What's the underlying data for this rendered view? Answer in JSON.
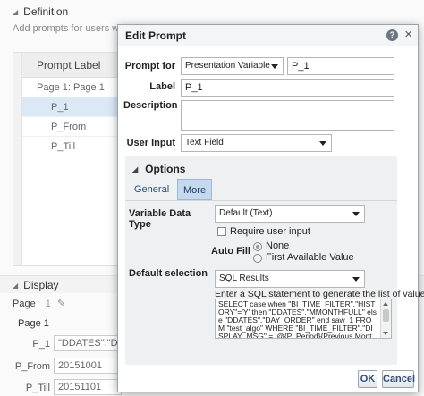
{
  "background": {
    "definition_header": "Definition",
    "definition_desc": "Add prompts for users when",
    "table_header": "Prompt Label",
    "rows": [
      {
        "label": "Page 1: Page 1"
      },
      {
        "label": "P_1"
      },
      {
        "label": "P_From"
      },
      {
        "label": "P_Till"
      }
    ],
    "display_header": "Display",
    "page_label": "Page",
    "page_value": "1",
    "page_section": "Page 1",
    "fields": [
      {
        "label": "P_1",
        "value": "\"DDATES\".\"DAY_"
      },
      {
        "label": "P_From",
        "value": "20151001"
      },
      {
        "label": "P_Till",
        "value": "20151101"
      }
    ]
  },
  "dialog": {
    "title": "Edit Prompt",
    "help_icon_glyph": "?",
    "close_icon_glyph": "×",
    "prompt_for_label": "Prompt for",
    "prompt_for_value": "Presentation Variable",
    "variable_name": "P_1",
    "label_label": "Label",
    "label_value": "P_1",
    "description_label": "Description",
    "description_value": "",
    "user_input_label": "User Input",
    "user_input_value": "Text Field",
    "options_header": "Options",
    "tabs": [
      {
        "label": "General",
        "active": false
      },
      {
        "label": "More",
        "active": true
      }
    ],
    "variable_data_type_label": "Variable Data Type",
    "variable_data_type_value": "Default (Text)",
    "require_user_input_label": "Require user input",
    "require_user_input_checked": false,
    "auto_fill_label": "Auto Fill",
    "auto_fill_options": [
      {
        "label": "None",
        "selected": true
      },
      {
        "label": "First Available Value",
        "selected": false
      }
    ],
    "default_selection_label": "Default selection",
    "default_selection_value": "SQL Results",
    "sql_instruction": "Enter a SQL statement to generate the list of values.",
    "sql_text": "SELECT case when \"BI_TIME_FILTER\".\"HISTORY\"='Y' then \"DDATES\".\"MMONTHFULL\" else \"DDATES\".\"DAY_ORDER\" end saw_1 FROM \"test_algo\" WHERE \"BI_TIME_FILTER\".\"DISPLAY_MSG\" = '@{P_Period}{Previous Month}'",
    "ok_label": "OK",
    "cancel_label": "Cancel"
  },
  "colors": {
    "selected_row": "#dbe9f7",
    "active_tab": "#c4d9ee",
    "link_text": "#2b4c7e"
  }
}
